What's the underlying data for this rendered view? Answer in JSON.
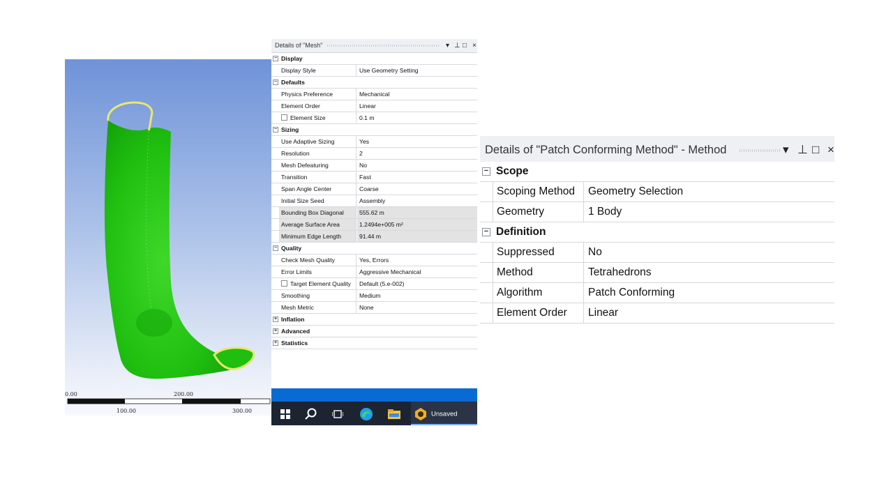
{
  "viewport": {
    "scale_labels": {
      "left_top": "0.00",
      "mid_top": "200.00",
      "left_bottom": "100.00",
      "right_bottom": "300.00"
    }
  },
  "mesh_panel": {
    "title": "Details of \"Mesh\"",
    "rows": [
      {
        "type": "section",
        "toggle": "−",
        "label": "Display"
      },
      {
        "type": "prop",
        "key": "Display Style",
        "value": "Use Geometry Setting"
      },
      {
        "type": "section",
        "toggle": "−",
        "label": "Defaults"
      },
      {
        "type": "prop",
        "key": "Physics Preference",
        "value": "Mechanical"
      },
      {
        "type": "prop",
        "key": "Element Order",
        "value": "Linear"
      },
      {
        "type": "prop",
        "key": "Element Size",
        "value": "0.1 m",
        "checkbox": true
      },
      {
        "type": "section",
        "toggle": "−",
        "label": "Sizing"
      },
      {
        "type": "prop",
        "key": "Use Adaptive Sizing",
        "value": "Yes"
      },
      {
        "type": "prop",
        "key": "Resolution",
        "value": "2"
      },
      {
        "type": "prop",
        "key": "Mesh Defeaturing",
        "value": "No"
      },
      {
        "type": "prop",
        "key": "Transition",
        "value": "Fast"
      },
      {
        "type": "prop",
        "key": "Span Angle Center",
        "value": "Coarse"
      },
      {
        "type": "prop",
        "key": "Initial Size Seed",
        "value": "Assembly"
      },
      {
        "type": "prop",
        "key": "Bounding Box Diagonal",
        "value": "555.62 m",
        "readonly": true
      },
      {
        "type": "prop",
        "key": "Average Surface Area",
        "value": "1.2494e+005 m²",
        "readonly": true
      },
      {
        "type": "prop",
        "key": "Minimum Edge Length",
        "value": "91.44 m",
        "readonly": true
      },
      {
        "type": "section",
        "toggle": "−",
        "label": "Quality"
      },
      {
        "type": "prop",
        "key": "Check Mesh Quality",
        "value": "Yes, Errors"
      },
      {
        "type": "prop",
        "key": "Error Limits",
        "value": "Aggressive Mechanical"
      },
      {
        "type": "prop",
        "key": "Target Element Quality",
        "value": "Default (5.e-002)",
        "checkbox": true
      },
      {
        "type": "prop",
        "key": "Smoothing",
        "value": "Medium"
      },
      {
        "type": "prop",
        "key": "Mesh Metric",
        "value": "None"
      },
      {
        "type": "section",
        "toggle": "+",
        "label": "Inflation"
      },
      {
        "type": "section",
        "toggle": "+",
        "label": "Advanced"
      },
      {
        "type": "section",
        "toggle": "+",
        "label": "Statistics"
      }
    ]
  },
  "taskbar": {
    "start_icon": "windows-start-icon",
    "search_icon": "search-icon",
    "taskview_icon": "task-view-icon",
    "edge_icon": "edge-browser-icon",
    "folder_icon": "file-explorer-icon",
    "app_label": "Unsaved Project"
  },
  "pcm_panel": {
    "title": "Details of \"Patch Conforming Method\" - Method",
    "rows": [
      {
        "type": "section",
        "toggle": "−",
        "label": "Scope"
      },
      {
        "type": "prop",
        "key": "Scoping Method",
        "value": "Geometry Selection"
      },
      {
        "type": "prop",
        "key": "Geometry",
        "value": "1 Body"
      },
      {
        "type": "section",
        "toggle": "−",
        "label": "Definition"
      },
      {
        "type": "prop",
        "key": "Suppressed",
        "value": "No"
      },
      {
        "type": "prop",
        "key": "Method",
        "value": "Tetrahedrons"
      },
      {
        "type": "prop",
        "key": "Algorithm",
        "value": "Patch Conforming"
      },
      {
        "type": "prop",
        "key": "Element Order",
        "value": "Linear"
      }
    ]
  },
  "colors": {
    "model_green": "#1fbf10",
    "edge_yellow": "#e8e870",
    "viewport_top": "#6f93d8",
    "taskbar": "#1c2432",
    "taskbar_accent": "#0a6ad3"
  }
}
